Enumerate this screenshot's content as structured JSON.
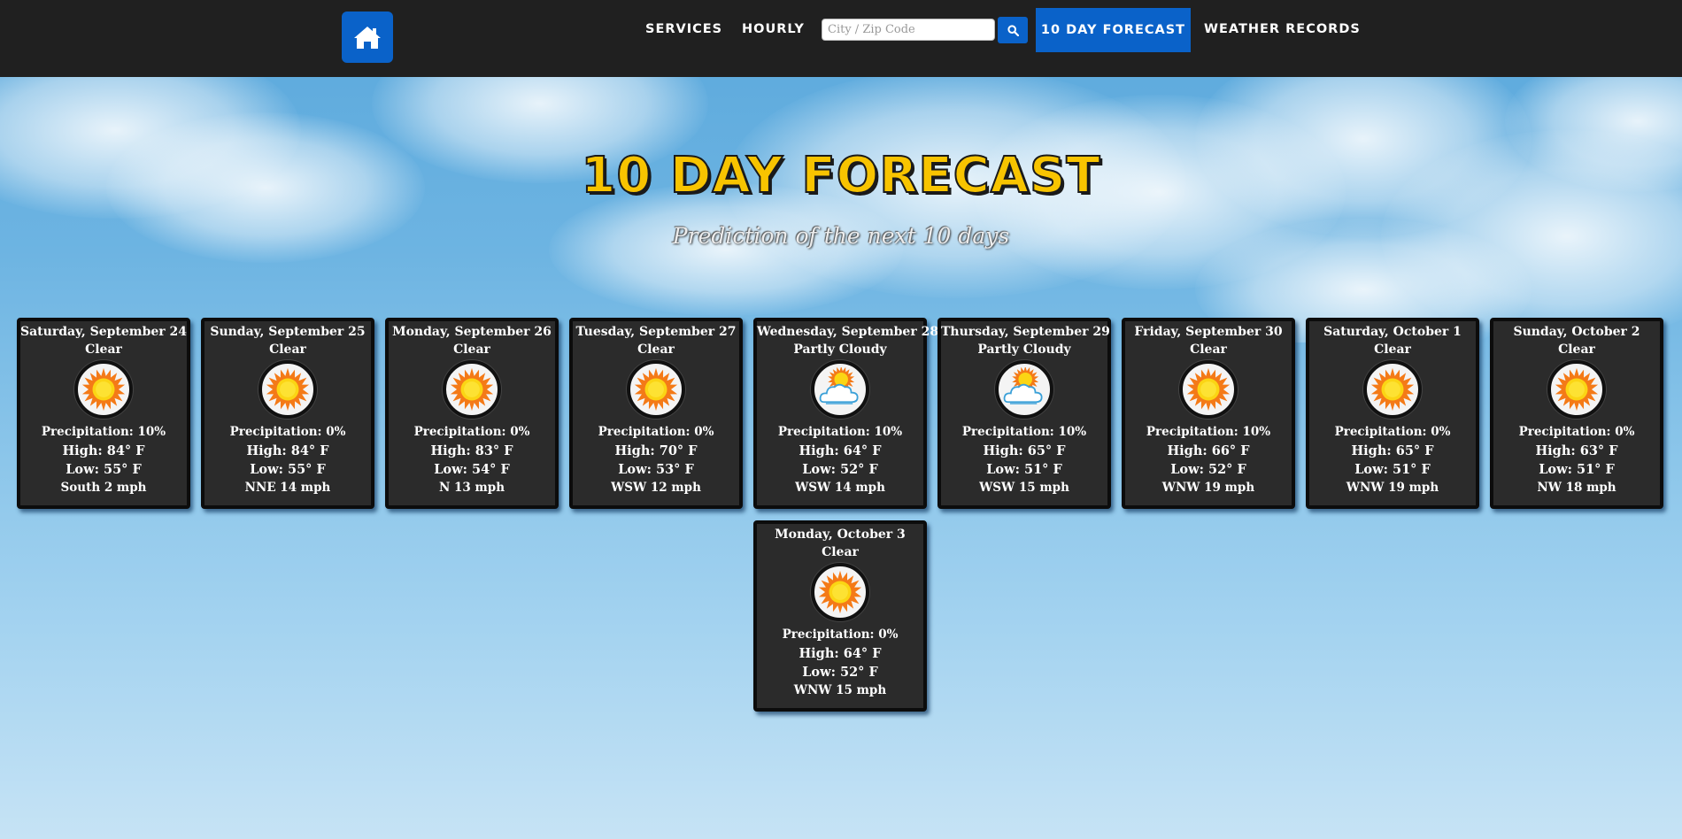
{
  "nav": {
    "links": [
      "SERVICES",
      "HOURLY"
    ],
    "search_placeholder": "City / Zip Code",
    "active_label": "10 DAY FORECAST",
    "records_label": "WEATHER RECORDS"
  },
  "hero": {
    "title": "10 DAY FORECAST",
    "subtitle": "Prediction of the next 10 days"
  },
  "forecast": [
    {
      "day": "Saturday, September 24",
      "condition": "Clear",
      "icon": "sun-icon",
      "precipitation": "Precipitation: 10%",
      "high": "High: 84° F",
      "low": "Low: 55° F",
      "wind": "South 2 mph"
    },
    {
      "day": "Sunday, September 25",
      "condition": "Clear",
      "icon": "sun-icon",
      "precipitation": "Precipitation: 0%",
      "high": "High: 84° F",
      "low": "Low: 55° F",
      "wind": "NNE 14 mph"
    },
    {
      "day": "Monday, September 26",
      "condition": "Clear",
      "icon": "sun-icon",
      "precipitation": "Precipitation: 0%",
      "high": "High: 83° F",
      "low": "Low: 54° F",
      "wind": "N 13 mph"
    },
    {
      "day": "Tuesday, September 27",
      "condition": "Clear",
      "icon": "sun-icon",
      "precipitation": "Precipitation: 0%",
      "high": "High: 70° F",
      "low": "Low: 53° F",
      "wind": "WSW 12 mph"
    },
    {
      "day": "Wednesday, September 28",
      "condition": "Partly Cloudy",
      "icon": "partly-cloudy-icon",
      "precipitation": "Precipitation: 10%",
      "high": "High: 64° F",
      "low": "Low: 52° F",
      "wind": "WSW 14 mph"
    },
    {
      "day": "Thursday, September 29",
      "condition": "Partly Cloudy",
      "icon": "partly-cloudy-icon",
      "precipitation": "Precipitation: 10%",
      "high": "High: 65° F",
      "low": "Low: 51° F",
      "wind": "WSW 15 mph"
    },
    {
      "day": "Friday, September 30",
      "condition": "Clear",
      "icon": "sun-icon",
      "precipitation": "Precipitation: 10%",
      "high": "High: 66° F",
      "low": "Low: 52° F",
      "wind": "WNW 19 mph"
    },
    {
      "day": "Saturday, October 1",
      "condition": "Clear",
      "icon": "sun-icon",
      "precipitation": "Precipitation: 0%",
      "high": "High: 65° F",
      "low": "Low: 51° F",
      "wind": "WNW 19 mph"
    },
    {
      "day": "Sunday, October 2",
      "condition": "Clear",
      "icon": "sun-icon",
      "precipitation": "Precipitation: 0%",
      "high": "High: 63° F",
      "low": "Low: 51° F",
      "wind": "NW 18 mph"
    },
    {
      "day": "Monday, October 3",
      "condition": "Clear",
      "icon": "sun-icon",
      "precipitation": "Precipitation: 0%",
      "high": "High: 64° F",
      "low": "Low: 52° F",
      "wind": "WNW 15 mph"
    }
  ],
  "colors": {
    "nav_bg": "#202020",
    "accent_blue": "#0a62c9",
    "title_yellow": "#f8c400",
    "card_bg": "#2b2b2b"
  }
}
